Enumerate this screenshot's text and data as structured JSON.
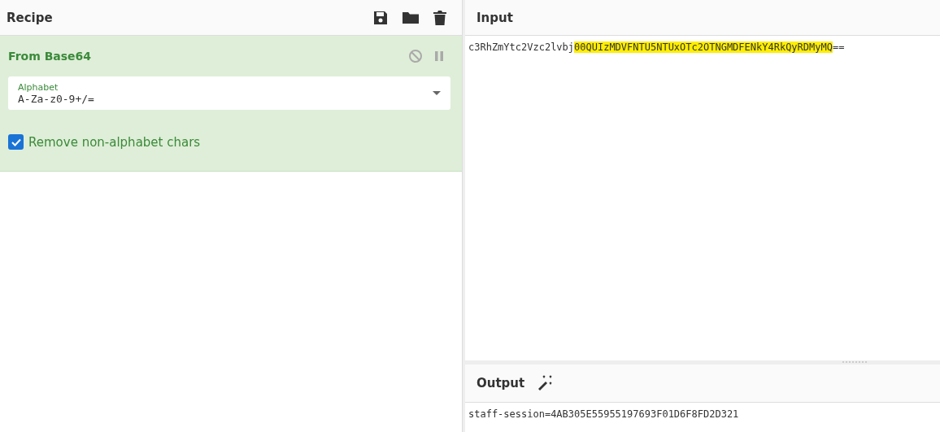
{
  "recipe": {
    "title": "Recipe",
    "operations": [
      {
        "name": "From Base64",
        "disabled": false,
        "paused": false,
        "fields": [
          {
            "kind": "dropdown",
            "label": "Alphabet",
            "value": "A-Za-z0-9+/="
          },
          {
            "kind": "checkbox",
            "label": "Remove non-alphabet chars",
            "checked": true
          }
        ]
      }
    ]
  },
  "input": {
    "title": "Input",
    "segments": [
      {
        "text": "c3RhZmYtc2Vzc2lvbj",
        "highlighted": false
      },
      {
        "text": "00QUIzMDVFNTU5NTUxOTc2OTNGMDFENkY4RkQyRDMyMQ",
        "highlighted": true
      },
      {
        "text": "==",
        "highlighted": false
      }
    ]
  },
  "output": {
    "title": "Output",
    "text": "staff-session=4AB305E55955197693F01D6F8FD2D321"
  }
}
